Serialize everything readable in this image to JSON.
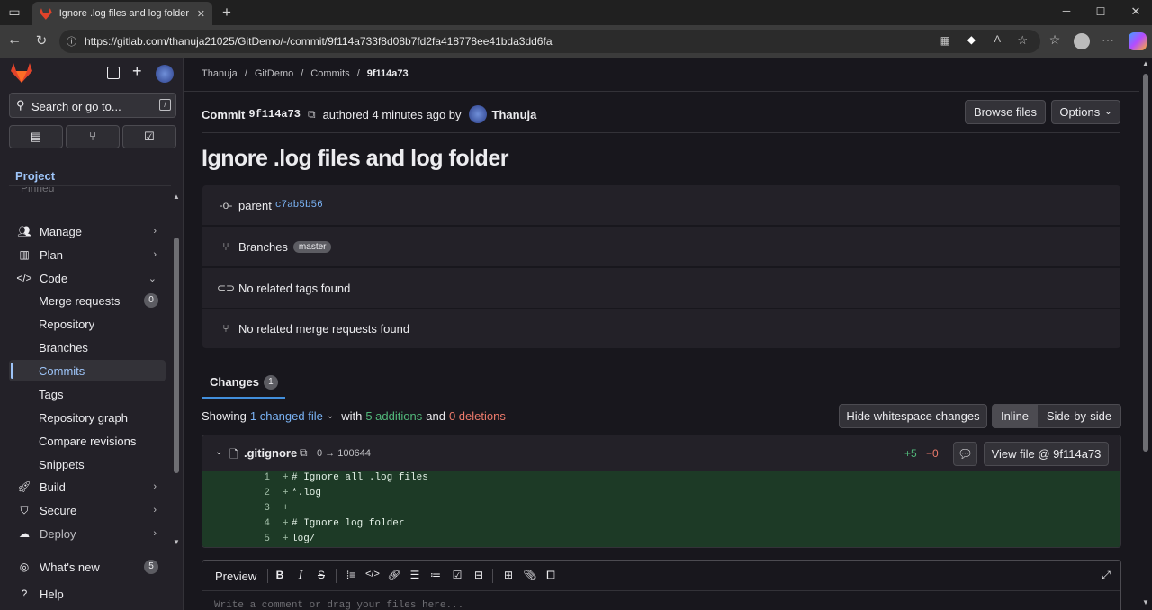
{
  "browser": {
    "tab_title": "Ignore .log files and log folder (9f",
    "url": "https://gitlab.com/thanuja21025/GitDemo/-/commit/9f114a733f8d08b7fd2fa418778ee41bda3dd6fa",
    "new_tab_glyph": "+",
    "minimize_glyph": "─",
    "maximize_glyph": "☐",
    "close_glyph": "✕"
  },
  "sidebar": {
    "search_placeholder": "Search or go to...",
    "search_shortcut": "/",
    "section_title": "Project",
    "pinned_label": "Pinned",
    "items": [
      {
        "label": "Manage",
        "icon": "users-icon"
      },
      {
        "label": "Plan",
        "icon": "plan-icon"
      },
      {
        "label": "Code",
        "icon": "code-icon"
      }
    ],
    "code_subitems": [
      {
        "label": "Merge requests",
        "count": "0"
      },
      {
        "label": "Repository"
      },
      {
        "label": "Branches"
      },
      {
        "label": "Commits"
      },
      {
        "label": "Tags"
      },
      {
        "label": "Repository graph"
      },
      {
        "label": "Compare revisions"
      },
      {
        "label": "Snippets"
      }
    ],
    "items_after": [
      {
        "label": "Build",
        "icon": "rocket-icon"
      },
      {
        "label": "Secure",
        "icon": "shield-icon"
      },
      {
        "label": "Deploy",
        "icon": "deploy-icon"
      }
    ],
    "whats_new": "What's new",
    "whats_new_count": "5",
    "help": "Help"
  },
  "breadcrumb": [
    "Thanuja",
    "GitDemo",
    "Commits",
    "9f114a73"
  ],
  "commit": {
    "label": "Commit",
    "short_sha": "9f114a73",
    "authored_text": "authored 4 minutes ago by",
    "author": "Thanuja",
    "title": "Ignore .log files and log folder",
    "browse_files": "Browse files",
    "options": "Options",
    "parent_label": "parent",
    "parent_sha": "c7ab5b56",
    "branches_label": "Branches",
    "branch_name": "master",
    "tags_text": "No related tags found",
    "mr_text": "No related merge requests found"
  },
  "changes": {
    "tab_label": "Changes",
    "tab_count": "1",
    "showing": "Showing",
    "changed_file": "1 changed file",
    "with": "with",
    "additions": "5 additions",
    "and": "and",
    "deletions": "0 deletions",
    "hide_whitespace": "Hide whitespace changes",
    "inline": "Inline",
    "side_by_side": "Side-by-side"
  },
  "file": {
    "name": ".gitignore",
    "mode": "0 → 100644",
    "plus": "+5",
    "minus": "−0",
    "view_file": "View file @ 9f114a73",
    "lines": [
      {
        "n": "1",
        "text": "# Ignore all .log files"
      },
      {
        "n": "2",
        "text": "*.log"
      },
      {
        "n": "3",
        "text": ""
      },
      {
        "n": "4",
        "text": "# Ignore log folder"
      },
      {
        "n": "5",
        "text": "log/"
      }
    ]
  },
  "editor": {
    "preview": "Preview",
    "placeholder": "Write a comment or drag your files here..."
  },
  "colors": {
    "accent_link": "#7ab3f5",
    "additions": "#52b87a",
    "deletions": "#ec7a6b",
    "diff_bg": "#1d3a26",
    "gitlab_orange": "#e2432a"
  }
}
